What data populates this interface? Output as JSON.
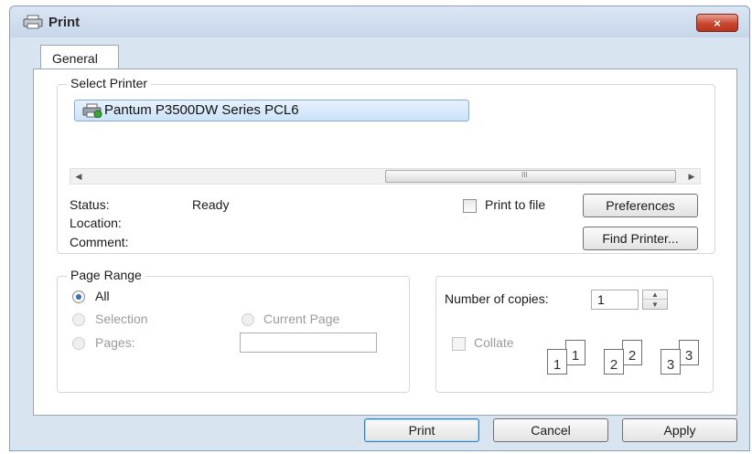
{
  "window": {
    "title": "Print",
    "close_glyph": "×"
  },
  "tabs": [
    {
      "label": "General",
      "selected": true
    }
  ],
  "select_printer": {
    "legend": "Select Printer",
    "printers": [
      {
        "name": "Pantum P3500DW Series PCL6",
        "icon": "printer-icon",
        "selected": true
      }
    ],
    "scroll_grip": "III"
  },
  "status": {
    "status_label": "Status:",
    "status_value": "Ready",
    "location_label": "Location:",
    "location_value": "",
    "comment_label": "Comment:",
    "comment_value": ""
  },
  "print_to_file": {
    "label": "Print to file",
    "checked": false
  },
  "buttons": {
    "preferences": "Preferences",
    "find_printer": "Find Printer...",
    "print": "Print",
    "cancel": "Cancel",
    "apply": "Apply"
  },
  "page_range": {
    "legend": "Page Range",
    "all": "All",
    "selection": "Selection",
    "current_page": "Current Page",
    "pages": "Pages:",
    "pages_value": "",
    "selected": "All"
  },
  "copies": {
    "label": "Number of copies:",
    "value": "1",
    "collate_label": "Collate",
    "collate_checked": false,
    "illustration_numbers": [
      "1",
      "1",
      "2",
      "2",
      "3",
      "3"
    ]
  },
  "colors": {
    "title_bar": "#c6d6ea",
    "close_button": "#c8462f",
    "selection": "#cde2f8",
    "default_button_border": "#3c7fb1"
  }
}
